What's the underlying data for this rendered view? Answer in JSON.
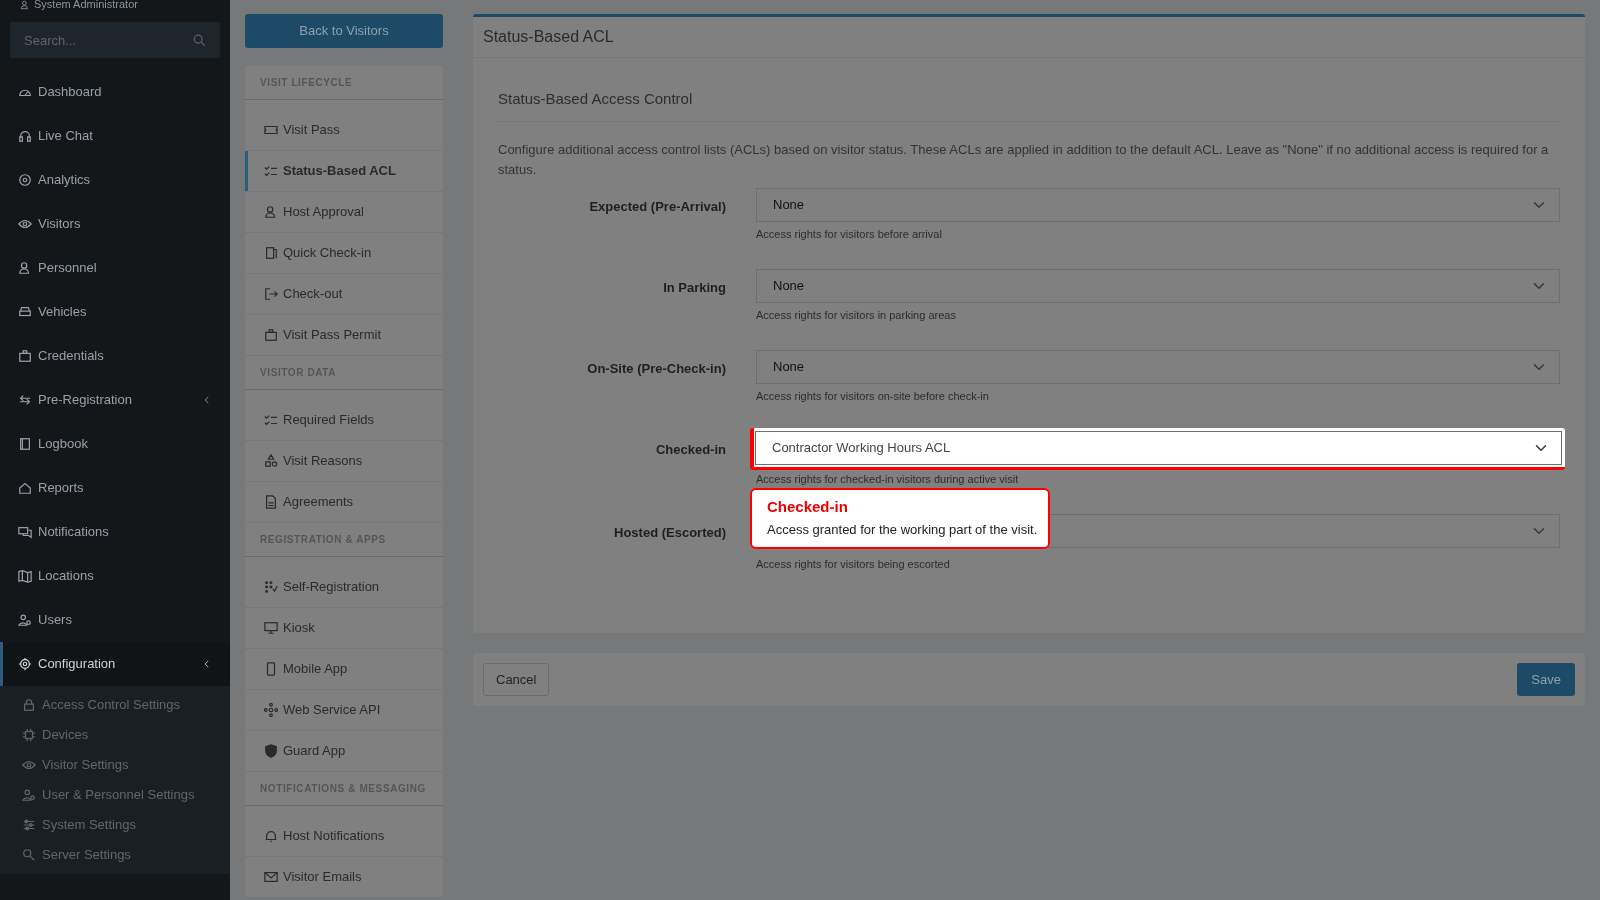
{
  "user": {
    "name": "System Administrator"
  },
  "search": {
    "placeholder": "Search..."
  },
  "sidebar": {
    "items": [
      {
        "label": "Dashboard",
        "selected": false
      },
      {
        "label": "Live Chat",
        "selected": false
      },
      {
        "label": "Analytics",
        "selected": false
      },
      {
        "label": "Visitors",
        "selected": false
      },
      {
        "label": "Personnel",
        "selected": false
      },
      {
        "label": "Vehicles",
        "selected": false
      },
      {
        "label": "Credentials",
        "selected": false
      },
      {
        "label": "Pre-Registration",
        "selected": false,
        "expanded": false
      },
      {
        "label": "Logbook",
        "selected": false
      },
      {
        "label": "Reports",
        "selected": false
      },
      {
        "label": "Notifications",
        "selected": false
      },
      {
        "label": "Locations",
        "selected": false
      },
      {
        "label": "Users",
        "selected": false
      },
      {
        "label": "Configuration",
        "selected": true,
        "expanded": true,
        "children": [
          {
            "label": "Access Control Settings"
          },
          {
            "label": "Devices"
          },
          {
            "label": "Visitor Settings"
          },
          {
            "label": "User & Personnel Settings"
          },
          {
            "label": "System Settings"
          },
          {
            "label": "Server Settings"
          }
        ]
      }
    ]
  },
  "back_button": {
    "label": "Back to Visitors"
  },
  "settings_nav": {
    "sections": [
      {
        "title": "VISIT LIFECYCLE",
        "items": [
          {
            "label": "Visit Pass",
            "selected": false
          },
          {
            "label": "Status-Based ACL",
            "selected": true
          },
          {
            "label": "Host Approval",
            "selected": false
          },
          {
            "label": "Quick Check-in",
            "selected": false
          },
          {
            "label": "Check-out",
            "selected": false
          },
          {
            "label": "Visit Pass Permit",
            "selected": false
          }
        ]
      },
      {
        "title": "VISITOR DATA",
        "items": [
          {
            "label": "Required Fields",
            "selected": false
          },
          {
            "label": "Visit Reasons",
            "selected": false
          },
          {
            "label": "Agreements",
            "selected": false
          }
        ]
      },
      {
        "title": "REGISTRATION & APPS",
        "items": [
          {
            "label": "Self-Registration",
            "selected": false
          },
          {
            "label": "Kiosk",
            "selected": false
          },
          {
            "label": "Mobile App",
            "selected": false
          },
          {
            "label": "Web Service API",
            "selected": false
          },
          {
            "label": "Guard App",
            "selected": false
          }
        ]
      },
      {
        "title": "NOTIFICATIONS & MESSAGING",
        "items": [
          {
            "label": "Host Notifications",
            "selected": false
          },
          {
            "label": "Visitor Emails",
            "selected": false
          }
        ]
      }
    ]
  },
  "panel": {
    "title": "Status-Based ACL",
    "section_title": "Status-Based Access Control",
    "description": "Configure additional access control lists (ACLs) based on visitor status. These ACLs are applied in addition to the default ACL. Leave as \"None\" if no additional access is required for a status.",
    "fields": [
      {
        "label": "Expected (Pre-Arrival)",
        "value": "None",
        "help": "Access rights for visitors before arrival",
        "highlighted": false
      },
      {
        "label": "In Parking",
        "value": "None",
        "help": "Access rights for visitors in parking areas",
        "highlighted": false
      },
      {
        "label": "On-Site (Pre-Check-in)",
        "value": "None",
        "help": "Access rights for visitors on-site before check-in",
        "highlighted": false
      },
      {
        "label": "Checked-in",
        "value": "Contractor Working Hours ACL",
        "help": "Access rights for checked-in visitors during active visit",
        "highlighted": true
      },
      {
        "label": "Hosted (Escorted)",
        "help": "Access rights for visitors being escorted",
        "highlighted": false
      }
    ],
    "popover": {
      "title": "Checked-in",
      "text": "Access granted for the working part of the visit."
    },
    "buttons": {
      "cancel": "Cancel",
      "save": "Save"
    }
  }
}
